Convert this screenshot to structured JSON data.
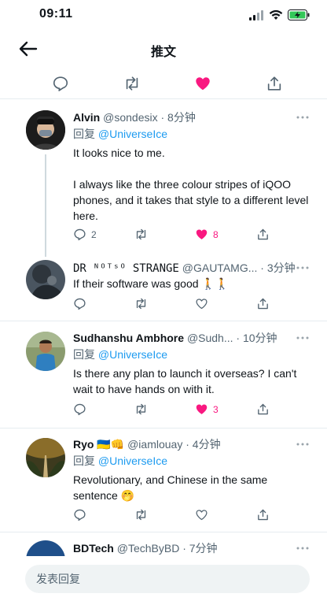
{
  "status_bar": {
    "time": "09:11"
  },
  "header": {
    "title": "推文"
  },
  "colors": {
    "accent": "#1d9bf0",
    "like": "#f91880",
    "text": "#0f1419",
    "muted": "#536471"
  },
  "replies": [
    {
      "name": "Alvin",
      "handle": "@sondesix",
      "time": "· 8分钟",
      "reply_label": "回复",
      "reply_to": "@UniverseIce",
      "text": "It looks nice to me.\n\nI always like the three colour stripes of iQOO phones, and it takes that style to a different level here.",
      "reply_count": "2",
      "like_count": "8",
      "liked": true
    },
    {
      "name": "DR ᴺᴼᵀˢᴼ STRANGE",
      "handle": "@GAUTAMG...",
      "time": "· 3分钟",
      "text": "If their software was good 🚶🚶",
      "liked": false
    },
    {
      "name": "Sudhanshu Ambhore",
      "handle": "@Sudh...",
      "time": "· 10分钟",
      "reply_label": "回复",
      "reply_to": "@UniverseIce",
      "text": "Is there any plan to launch it overseas? I can't wait to have hands on with it.",
      "like_count": "3",
      "liked": true
    },
    {
      "name": "Ryo 🇺🇦👊",
      "handle": "@iamlouay",
      "time": "· 4分钟",
      "reply_label": "回复",
      "reply_to": "@UniverseIce",
      "text": "Revolutionary, and Chinese in the same sentence 🤭",
      "liked": false
    },
    {
      "name": "BDTech",
      "handle": "@TechByBD",
      "time": "· 7分钟"
    }
  ],
  "compose": {
    "placeholder": "发表回复"
  }
}
